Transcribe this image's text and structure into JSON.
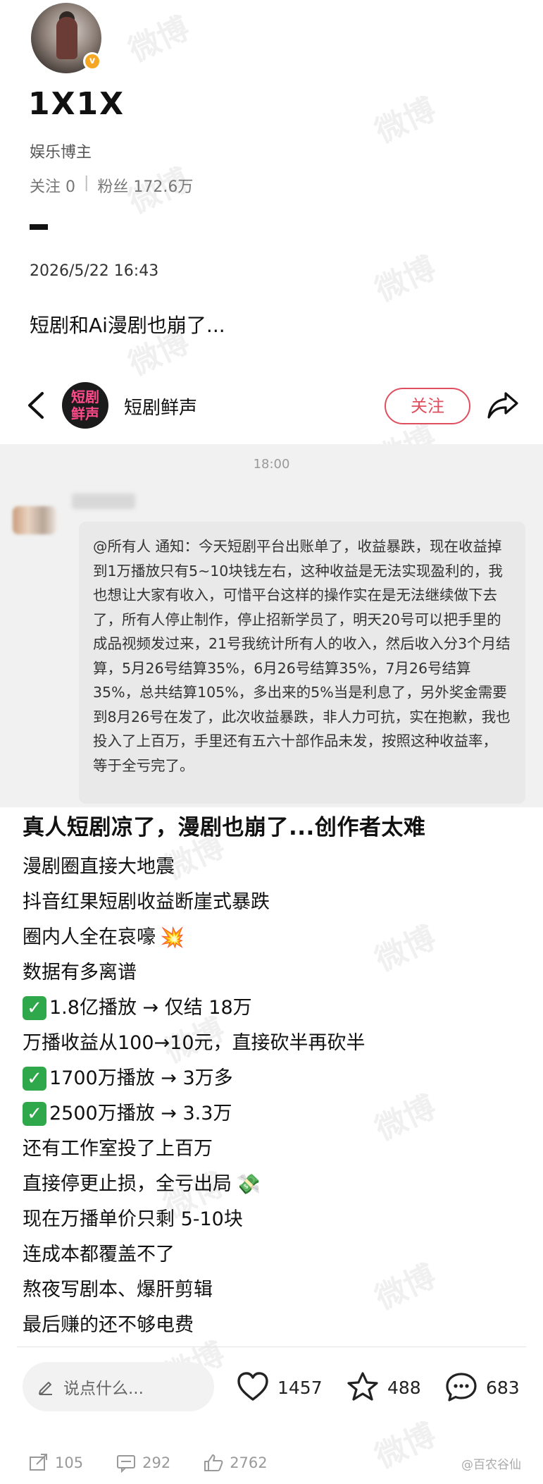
{
  "profile": {
    "username": "1X1X",
    "role": "娱乐博主",
    "following_label": "关注 0",
    "followers_label": "粉丝 172.6万",
    "dash": "–",
    "timestamp": "2026/5/22 16:43",
    "post_text": "短剧和Ai漫剧也崩了..."
  },
  "watermark": "微博",
  "screenshot": {
    "account_avatar_text": "短剧鲜声",
    "account_name": "短剧鲜声",
    "follow_label": "关注",
    "chat_time": "18:00",
    "message": "@所有人 通知：今天短剧平台出账单了，收益暴跌，现在收益掉到1万播放只有5~10块钱左右，这种收益是无法实现盈利的，我也想让大家有收入，可惜平台这样的操作实在是无法继续做下去了，所有人停止制作，停止招新学员了，明天20号可以把手里的成品视频发过来，21号我统计所有人的收入，然后收入分3个月结算，5月26号结算35%，6月26号结算35%，7月26号结算35%，总共结算105%，多出来的5%当是利息了，另外奖金需要到8月26号在发了，此次收益暴跌，非人力可抗，实在抱歉，我也投入了上百万，手里还有五六十部作品未发，按照这种收益率，等于全亏完了。",
    "title": "真人短剧凉了，漫剧也崩了...创作者太难",
    "lines": [
      {
        "text": "漫剧圈直接大地震"
      },
      {
        "text": "抖音红果短剧收益断崖式暴跌"
      },
      {
        "text": "圈内人全在哀嚎",
        "emoji": "💥"
      },
      {
        "text": "数据有多离谱"
      },
      {
        "text": "1.8亿播放 → 仅结 18万",
        "check": "✓"
      },
      {
        "text": "万播收益从100→10元，直接砍半再砍半"
      },
      {
        "text": "1700万播放 → 3万多",
        "check": "✓"
      },
      {
        "text": "2500万播放 → 3.3万",
        "check": "✓"
      },
      {
        "text": "还有工作室投了上百万"
      },
      {
        "text": "直接停更止损，全亏出局",
        "emoji": "💸"
      },
      {
        "text": "现在万播单价只剩 5-10块"
      },
      {
        "text": "连成本都覆盖不了"
      },
      {
        "text": "熬夜写剧本、爆肝剪辑"
      },
      {
        "text": "最后赚的还不够电费"
      }
    ],
    "comment_placeholder": "说点什么...",
    "likes": "1457",
    "favorites": "488",
    "comments": "683"
  },
  "footer": {
    "reposts": "105",
    "comments": "292",
    "likes": "2762",
    "credit": "@百农谷仙"
  },
  "colors": {
    "follow_red": "#e04f5f",
    "check_green": "#2ea84a",
    "bubble_bg": "#e9e9e9",
    "chat_bg": "#f1f1f1"
  }
}
